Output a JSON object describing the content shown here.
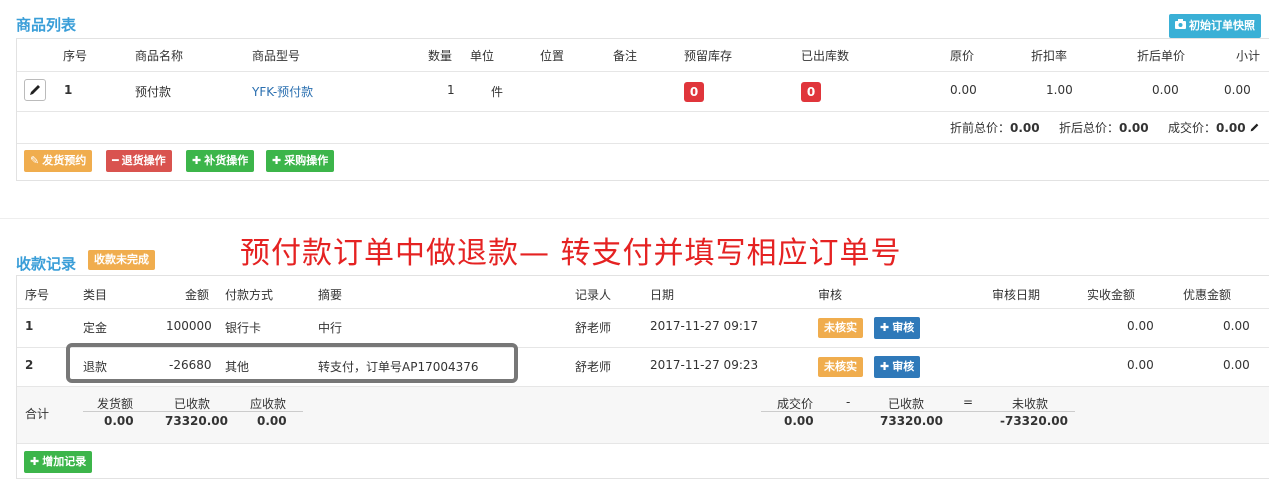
{
  "products": {
    "title": "商品列表",
    "snapshot_button": "初始订单快照",
    "headers": {
      "seq": "序号",
      "name": "商品名称",
      "model": "商品型号",
      "qty": "数量",
      "unit": "单位",
      "location": "位置",
      "remark": "备注",
      "reserved": "预留库存",
      "shipped": "已出库数",
      "price": "原价",
      "discount": "折扣率",
      "disc_price": "折后单价",
      "subtotal": "小计"
    },
    "rows": [
      {
        "seq": "1",
        "name": "预付款",
        "model": "YFK-预付款",
        "qty": "1",
        "unit": "件",
        "reserved": "0",
        "shipped": "0",
        "price": "0.00",
        "discount": "1.00",
        "disc_price": "0.00",
        "subtotal": "0.00"
      }
    ],
    "totals": {
      "before_label": "折前总价：",
      "before_value": "0.00",
      "after_label": "折后总价：",
      "after_value": "0.00",
      "deal_label": "成交价：",
      "deal_value": "0.00"
    },
    "actions": {
      "ship": "发货预约",
      "return": "退货操作",
      "restock": "补货操作",
      "purchase": "采购操作"
    }
  },
  "annotation": "预付款订单中做退款— 转支付并填写相应订单号",
  "payments": {
    "title": "收款记录",
    "status_badge": "收款未完成",
    "headers": {
      "seq": "序号",
      "category": "类目",
      "amount": "金额",
      "method": "付款方式",
      "summary": "摘要",
      "recorder": "记录人",
      "date": "日期",
      "audit": "审核",
      "audit_date": "审核日期",
      "received": "实收金额",
      "discount": "优惠金额"
    },
    "rows": [
      {
        "seq": "1",
        "category": "定金",
        "amount": "100000",
        "method": "银行卡",
        "summary": "中行",
        "recorder": "舒老师",
        "date": "2017-11-27 09:17",
        "status": "未核实",
        "audit_btn": "审核",
        "received": "0.00",
        "discount": "0.00"
      },
      {
        "seq": "2",
        "category": "退款",
        "amount": "-26680",
        "method": "其他",
        "summary": "转支付，订单号AP17004376",
        "recorder": "舒老师",
        "date": "2017-11-27 09:23",
        "status": "未核实",
        "audit_btn": "审核",
        "received": "0.00",
        "discount": "0.00"
      }
    ],
    "footer": {
      "total_label": "合计",
      "shipped_label": "发货额",
      "shipped_value": "0.00",
      "received_label": "已收款",
      "received_value": "73320.00",
      "due_label": "应收款",
      "due_value": "0.00",
      "deal_label": "成交价",
      "deal_value": "0.00",
      "minus": "-",
      "received2_label": "已收款",
      "received2_value": "73320.00",
      "equals": "=",
      "unreceived_label": "未收款",
      "unreceived_value": "-73320.00"
    },
    "add_button": "增加记录"
  },
  "colors": {
    "accent": "#3a9ed8",
    "danger": "#e0353b",
    "annotation": "#e52222"
  }
}
